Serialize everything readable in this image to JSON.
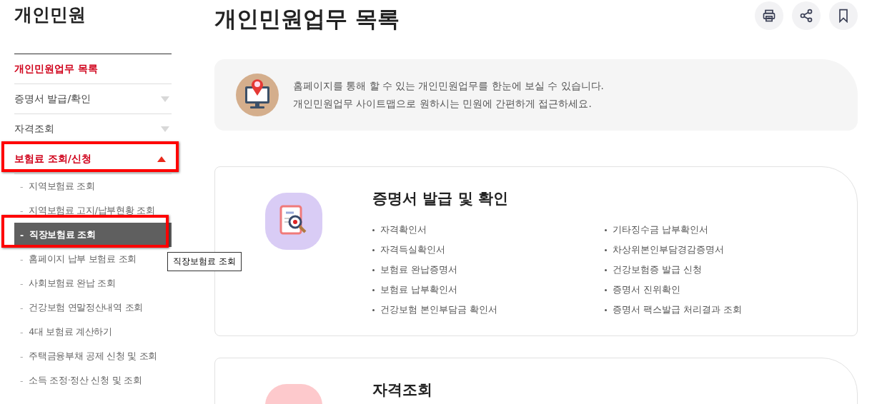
{
  "sidebar": {
    "title": "개인민원",
    "items": [
      {
        "label": "개인민원업무 목록",
        "kind": "link",
        "selected": true,
        "highlighted": false
      },
      {
        "label": "증명서 발급/확인",
        "kind": "group",
        "selected": false,
        "expanded": false,
        "highlighted": false
      },
      {
        "label": "자격조회",
        "kind": "group",
        "selected": false,
        "expanded": false,
        "highlighted": false
      },
      {
        "label": "보험료 조회/신청",
        "kind": "group",
        "selected": true,
        "expanded": true,
        "highlighted": true,
        "children": [
          {
            "bullet": "-",
            "label": "지역보험료 조회",
            "selected": false,
            "highlighted": false
          },
          {
            "bullet": "-",
            "label": "지역보험료 고지/납부현황 조회",
            "selected": false,
            "highlighted": false
          },
          {
            "bullet": "-",
            "label": "직장보험료 조회",
            "selected": true,
            "highlighted": true
          },
          {
            "bullet": "-",
            "label": "홈페이지 납부 보험료 조회",
            "selected": false,
            "highlighted": false
          },
          {
            "bullet": "-",
            "label": "사회보험료 완납 조회",
            "selected": false,
            "highlighted": false
          },
          {
            "bullet": "-",
            "label": "건강보험 연말정산내역 조회",
            "selected": false,
            "highlighted": false
          },
          {
            "bullet": "-",
            "label": "4대 보험료 계산하기",
            "selected": false,
            "highlighted": false
          },
          {
            "bullet": "-",
            "label": "주택금융부채 공제 신청 및 조회",
            "selected": false,
            "highlighted": false
          },
          {
            "bullet": "-",
            "label": "소득 조정·정산 신청 및 조회",
            "selected": false,
            "highlighted": false
          }
        ]
      }
    ]
  },
  "tooltip": "직장보험료 조회",
  "main": {
    "title": "개인민원업무 목록",
    "actions": [
      {
        "kind": "print"
      },
      {
        "kind": "share"
      },
      {
        "kind": "bookmark"
      }
    ],
    "intro": [
      "홈페이지를 통해 할 수 있는 개인민원업무를 한눈에 보실 수 있습니다.",
      "개인민원업무 사이트맵으로 원하시는 민원에 간편하게 접근하세요."
    ],
    "cards": [
      {
        "title": "증명서 발급 및 확인",
        "kind": "certificate",
        "color": "#d9ccf5",
        "links": [
          "자격확인서",
          "자격득실확인서",
          "보험료 완납증명서",
          "보험료 납부확인서",
          "건강보험 본인부담금 확인서",
          "기타징수금 납부확인서",
          "차상위본인부담경감증명서",
          "건강보험증 발급 신청",
          "증명서 진위확인",
          "증명서 팩스발급 처리결과 조회"
        ]
      },
      {
        "title": "자격조회",
        "kind": "qualification",
        "color": "#fdc9cc"
      }
    ]
  }
}
